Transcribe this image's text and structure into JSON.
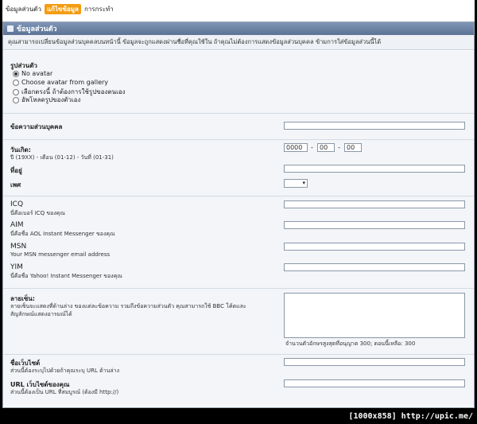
{
  "topnav": {
    "items": [
      "ข้อมูลส่วนตัว",
      "แก้ไขข้อมูล",
      "การกระทำ"
    ]
  },
  "panel": {
    "title": "ข้อมูลส่วนตัว",
    "intro": "คุณสามารถเปลี่ยนข้อมูลส่วนบุคคลบนหน้านี้ ข้อมูลจะถูกแสดงผ่านชื่อที่คุณใช้ใน ถ้าคุณไม่ต้องการแสดงข้อมูลส่วนบุคคล ข้ามการใส่ข้อมูลส่วนนี้ได้"
  },
  "avatar": {
    "label": "รูปส่วนตัว",
    "options": [
      "No avatar",
      "Choose avatar from gallery",
      "เลือกตรงนี้ ถ้าต้องการใช้รูปของตนเอง",
      "อัพโหลดรูปของตัวเอง"
    ],
    "selected_index": 0
  },
  "personal_text": {
    "label": "ข้อความส่วนบุคคล"
  },
  "birthday": {
    "label": "วันเกิด:",
    "hint": "ปี (19XX) - เดือน (01-12) - วันที่ (01-31)",
    "year": "0000",
    "month": "00",
    "day": "00",
    "sep": "-"
  },
  "location": {
    "label": "ที่อยู่"
  },
  "gender": {
    "label": "เพศ",
    "arrow": "▾"
  },
  "icq": {
    "label": "ICQ",
    "hint": "นี่คือเบอร์ ICQ ของคุณ"
  },
  "aim": {
    "label": "AIM",
    "hint": "นี่คือชื่อ AOL Instant Messenger ของคุณ"
  },
  "msn": {
    "label": "MSN",
    "hint": "Your MSN messenger email address"
  },
  "yim": {
    "label": "YIM",
    "hint": "นี่คือชื่อ Yahoo! Instant Messenger ของคุณ"
  },
  "signature": {
    "label": "ลายเซ็น:",
    "hint1": "ลายเซ็นจะแสดงที่ด้านล่าง ของแต่ละข้อความ รวมถึงข้อความส่วนตัว คุณสามารถใช้ BBC โค้ดและ",
    "hint2": "สัญลักษณ์แสดงอารมณ์ได้",
    "counter": "จำนวนตัวอักษรสูงสุดที่อนุญาต 300; ตอนนี้เหลือ: 300"
  },
  "website_title": {
    "label": "ชื่อเว็บไซต์",
    "hint": "ส่วนนี้ต้องระบุไปด้วยถ้าคุณระบุ URL ด้านล่าง"
  },
  "website_url": {
    "label": "URL เว็บไซต์ของคุณ",
    "hint": "ส่วนนี้ต้องเป็น URL ที่สมบูรณ์ (ต้องมี http://)"
  },
  "footer": "[1000x858] http://upic.me/"
}
